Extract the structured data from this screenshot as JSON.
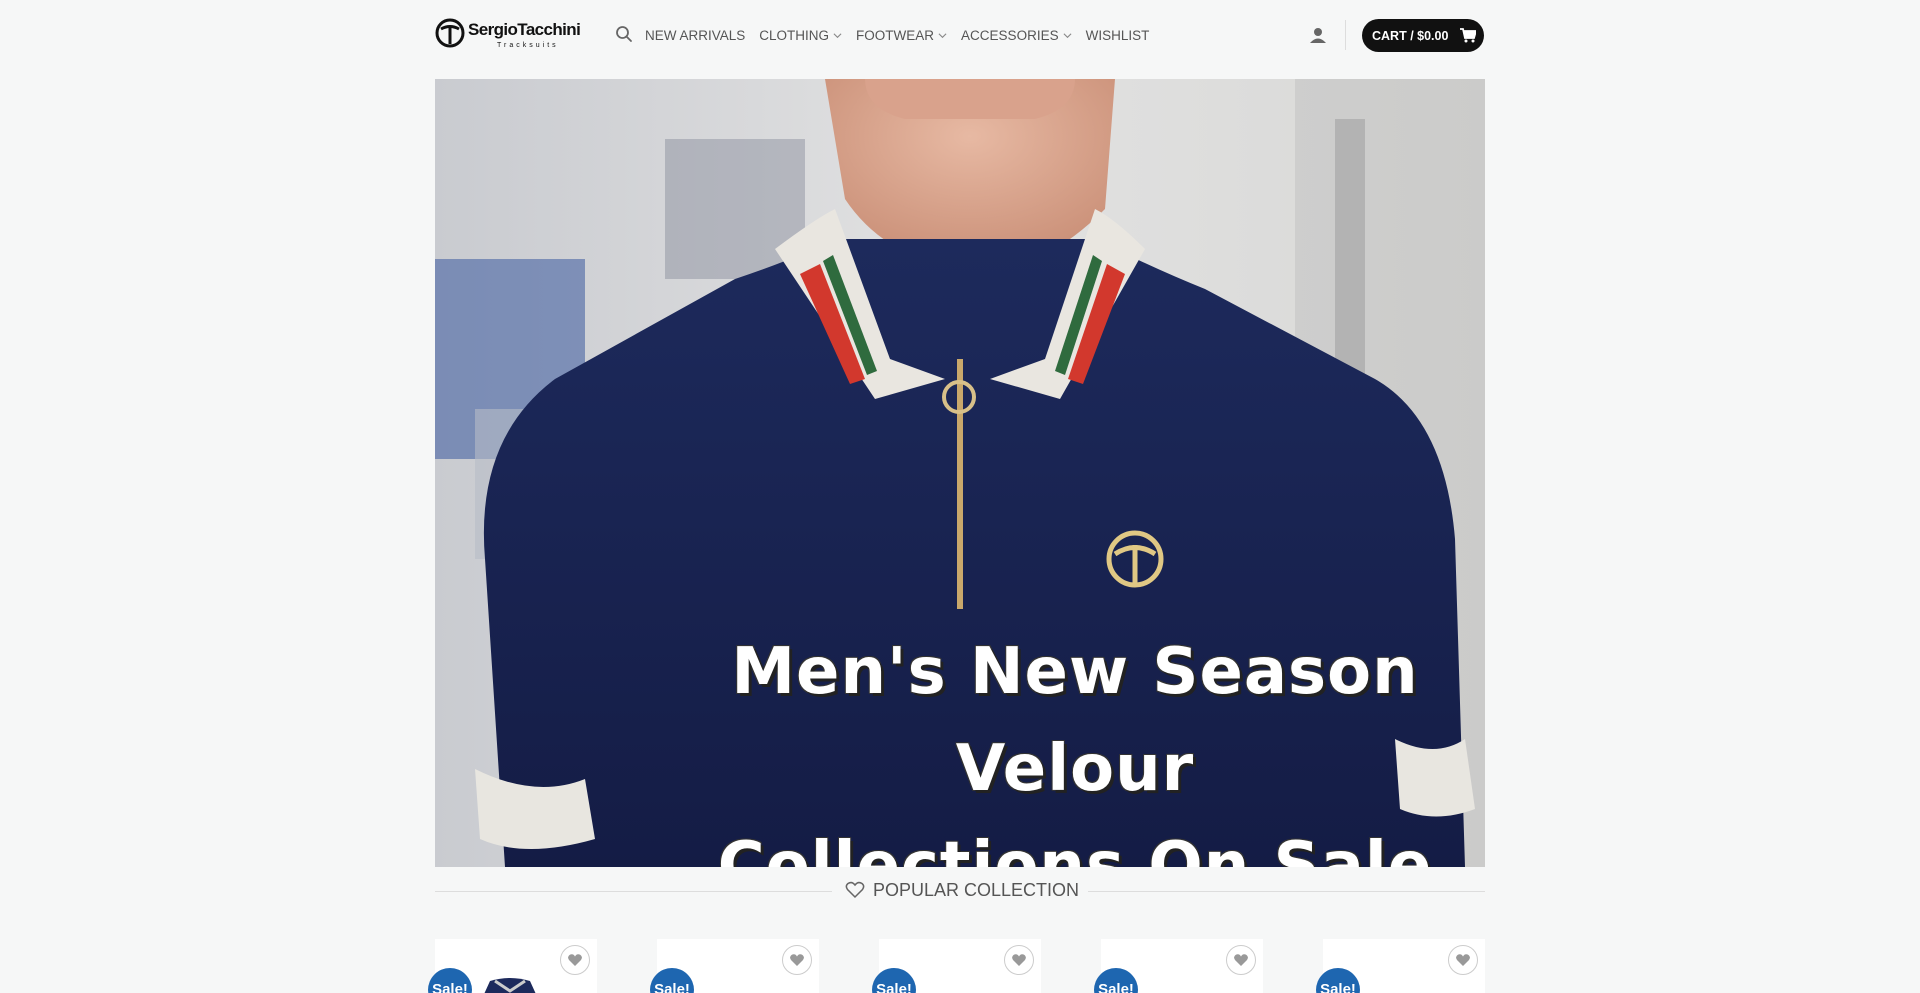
{
  "brand": {
    "name": "SergioTacchini",
    "tagline": "Tracksuits"
  },
  "nav": {
    "items": [
      {
        "label": "NEW ARRIVALS",
        "dropdown": false
      },
      {
        "label": "CLOTHING",
        "dropdown": true
      },
      {
        "label": "FOOTWEAR",
        "dropdown": true
      },
      {
        "label": "ACCESSORIES",
        "dropdown": true
      },
      {
        "label": "WISHLIST",
        "dropdown": false
      }
    ]
  },
  "cart": {
    "label": "CART / $0.00"
  },
  "hero": {
    "title_line1": "Men's New Season Velour",
    "title_line2": "Collections On Sale"
  },
  "section": {
    "title": "POPULAR COLLECTION"
  },
  "products": [
    {
      "badge": "Sale!"
    },
    {
      "badge": "Sale!"
    },
    {
      "badge": "Sale!"
    },
    {
      "badge": "Sale!"
    },
    {
      "badge": "Sale!"
    }
  ],
  "colors": {
    "cart_bg": "#111111",
    "sale_badge": "#1e66b0",
    "background": "#f6f7f7"
  }
}
